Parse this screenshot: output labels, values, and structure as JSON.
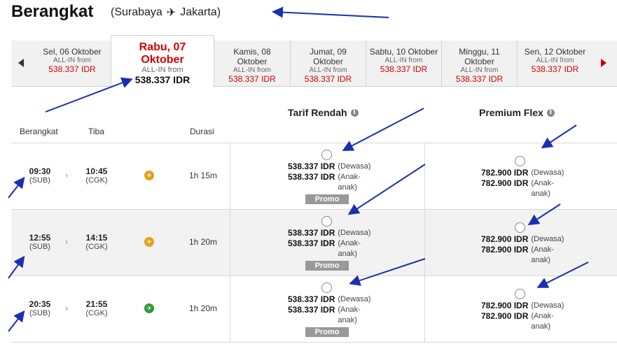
{
  "header": {
    "title": "Berangkat",
    "origin": "(Surabaya",
    "plane_glyph": "✈",
    "destination": "Jakarta)"
  },
  "dates": [
    {
      "day": "Sel, 06 Oktober",
      "day2": "",
      "allin": "ALL-IN from",
      "price": "538.337 IDR",
      "active": false
    },
    {
      "day": "Rabu, 07",
      "day2": "Oktober",
      "allin": "ALL-IN from",
      "price": "538.337 IDR",
      "active": true
    },
    {
      "day": "Kamis, 08",
      "day2": "Oktober",
      "allin": "ALL-IN from",
      "price": "538.337 IDR",
      "active": false
    },
    {
      "day": "Jumat, 09",
      "day2": "Oktober",
      "allin": "ALL-IN from",
      "price": "538.337 IDR",
      "active": false
    },
    {
      "day": "Sabtu, 10 Oktober",
      "day2": "",
      "allin": "ALL-IN from",
      "price": "538.337 IDR",
      "active": false
    },
    {
      "day": "Minggu, 11",
      "day2": "Oktober",
      "allin": "ALL-IN from",
      "price": "538.337 IDR",
      "active": false
    },
    {
      "day": "Sen, 12 Oktober",
      "day2": "",
      "allin": "ALL-IN from",
      "price": "538.337 IDR",
      "active": false
    }
  ],
  "fares": {
    "low": "Tarif Rendah",
    "premium": "Premium Flex",
    "info_glyph": "i"
  },
  "columns": {
    "depart": "Berangkat",
    "arrive": "Tiba",
    "duration": "Durasi"
  },
  "labels": {
    "adult": "(Dewasa)",
    "child1": "(Anak-",
    "child2": "anak)",
    "promo": "Promo"
  },
  "flights": [
    {
      "dep_time": "09:30",
      "dep_code": "(SUB)",
      "arr_time": "10:45",
      "arr_code": "(CGK)",
      "duration": "1h 15m",
      "logo_color": "#e0a21b",
      "low_adult": "538.337 IDR",
      "low_child": "538.337 IDR",
      "prem_adult": "782.900 IDR",
      "prem_child": "782.900 IDR"
    },
    {
      "dep_time": "12:55",
      "dep_code": "(SUB)",
      "arr_time": "14:15",
      "arr_code": "(CGK)",
      "duration": "1h 20m",
      "logo_color": "#e0a21b",
      "low_adult": "538.337 IDR",
      "low_child": "538.337 IDR",
      "prem_adult": "782.900 IDR",
      "prem_child": "782.900 IDR"
    },
    {
      "dep_time": "20:35",
      "dep_code": "(SUB)",
      "arr_time": "21:55",
      "arr_code": "(CGK)",
      "duration": "1h 20m",
      "logo_color": "#2e9a3a",
      "low_adult": "538.337 IDR",
      "low_child": "538.337 IDR",
      "prem_adult": "782.900 IDR",
      "prem_child": "782.900 IDR"
    }
  ],
  "colors": {
    "accent_red": "#d40000",
    "annotation_arrow": "#1a2fb0",
    "promo_bg": "#999999"
  }
}
